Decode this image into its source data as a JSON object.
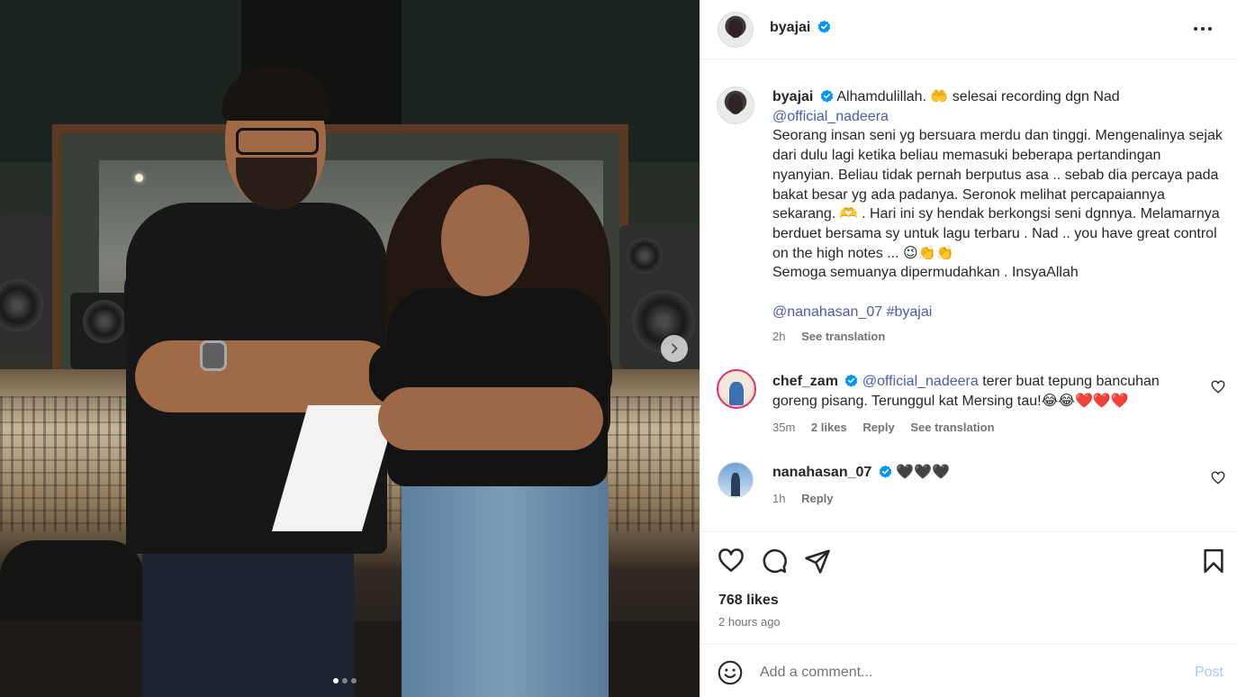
{
  "post": {
    "username": "byajai",
    "carousel": {
      "total": 3,
      "active": 1
    }
  },
  "caption": {
    "username": "byajai",
    "line1": "Alhamdulillah. 🤲 selesai recording dgn Nad",
    "mention": "@official_nadeera",
    "body": "Seorang insan seni yg bersuara merdu dan tinggi. Mengenalinya sejak dari dulu lagi ketika beliau memasuki beberapa pertandingan nyanyian. Beliau tidak pernah berputus asa .. sebab dia percaya pada bakat besar yg ada padanya. Seronok melihat percapaiannya sekarang. 🫶 . Hari ini sy hendak berkongsi seni dgnnya. Melamarnya berduet bersama sy untuk lagu terbaru . Nad .. you have great control on the high notes ... 😉👏👏",
    "line_last": "Semoga semuanya dipermudahkan . InsyaAllah",
    "tags": "@nanahasan_07 #byajai",
    "time": "2h",
    "see_translation": "See translation"
  },
  "comments": [
    {
      "username": "chef_zam",
      "mention": "@official_nadeera",
      "text": "terer buat tepung bancuhan goreng pisang. Terunggul kat Mersing tau!😂😂❤️❤️❤️",
      "time": "35m",
      "likes": "2 likes",
      "reply": "Reply",
      "see_translation": "See translation"
    },
    {
      "username": "nanahasan_07",
      "text": "🖤🖤🖤",
      "time": "1h",
      "reply": "Reply"
    }
  ],
  "actions": {
    "likes": "768 likes",
    "time_ago": "2 hours ago"
  },
  "add_comment": {
    "placeholder": "Add a comment...",
    "post_label": "Post"
  },
  "icons": {
    "more": "more-options-icon",
    "like": "heart-icon",
    "comment": "comment-bubble-icon",
    "share": "paper-plane-icon",
    "save": "bookmark-icon",
    "emoji": "smiley-icon",
    "verified": "verified-badge-icon",
    "next": "chevron-right-icon"
  },
  "colors": {
    "verified": "#0095f6",
    "link": "#4a5aad",
    "post_button": "#a7c9f4",
    "muted": "#737373"
  }
}
